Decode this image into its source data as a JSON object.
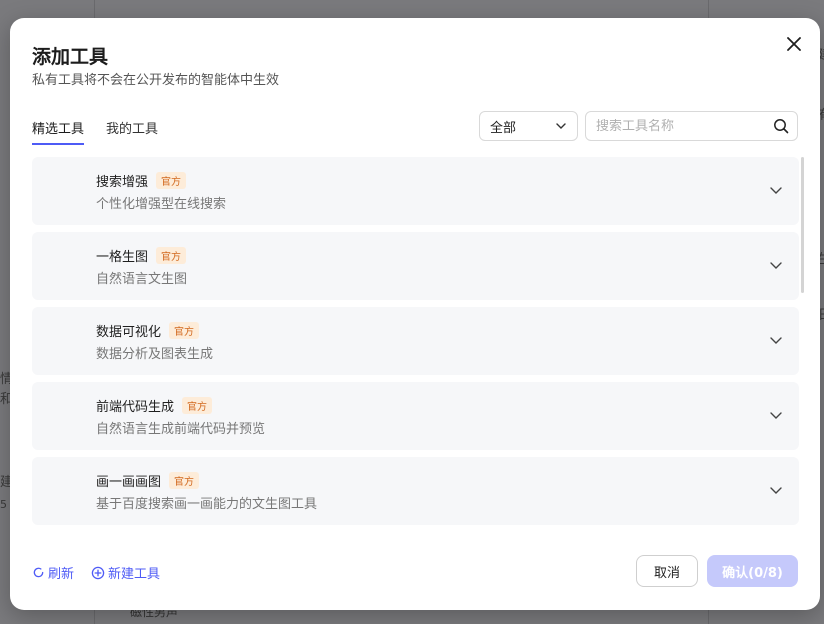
{
  "background": {
    "fragments": [
      "情",
      "和",
      "建",
      "5",
      "建",
      "有",
      "生",
      "日",
      "磁性男声"
    ]
  },
  "dialog": {
    "title": "添加工具",
    "subtitle": "私有工具将不会在公开发布的智能体中生效",
    "close_icon": "close-icon",
    "tabs": [
      {
        "label": "精选工具",
        "active": true
      },
      {
        "label": "我的工具",
        "active": false
      }
    ],
    "filter": {
      "selected": "全部"
    },
    "search": {
      "placeholder": "搜索工具名称",
      "value": ""
    },
    "tools": [
      {
        "name": "搜索增强",
        "badge": "官方",
        "desc": "个性化增强型在线搜索"
      },
      {
        "name": "一格生图",
        "badge": "官方",
        "desc": "自然语言文生图"
      },
      {
        "name": "数据可视化",
        "badge": "官方",
        "desc": "数据分析及图表生成"
      },
      {
        "name": "前端代码生成",
        "badge": "官方",
        "desc": "自然语言生成前端代码并预览"
      },
      {
        "name": "画一画画图",
        "badge": "官方",
        "desc": "基于百度搜索画一画能力的文生图工具"
      }
    ],
    "footer": {
      "refresh_label": "刷新",
      "new_tool_label": "新建工具",
      "cancel_label": "取消",
      "confirm_label": "确认(0/8)"
    }
  },
  "colors": {
    "accent": "#4e5bf6",
    "badge_text": "#d2691e",
    "badge_bg": "#fdecd9",
    "confirm_disabled": "#c5c9fb"
  }
}
